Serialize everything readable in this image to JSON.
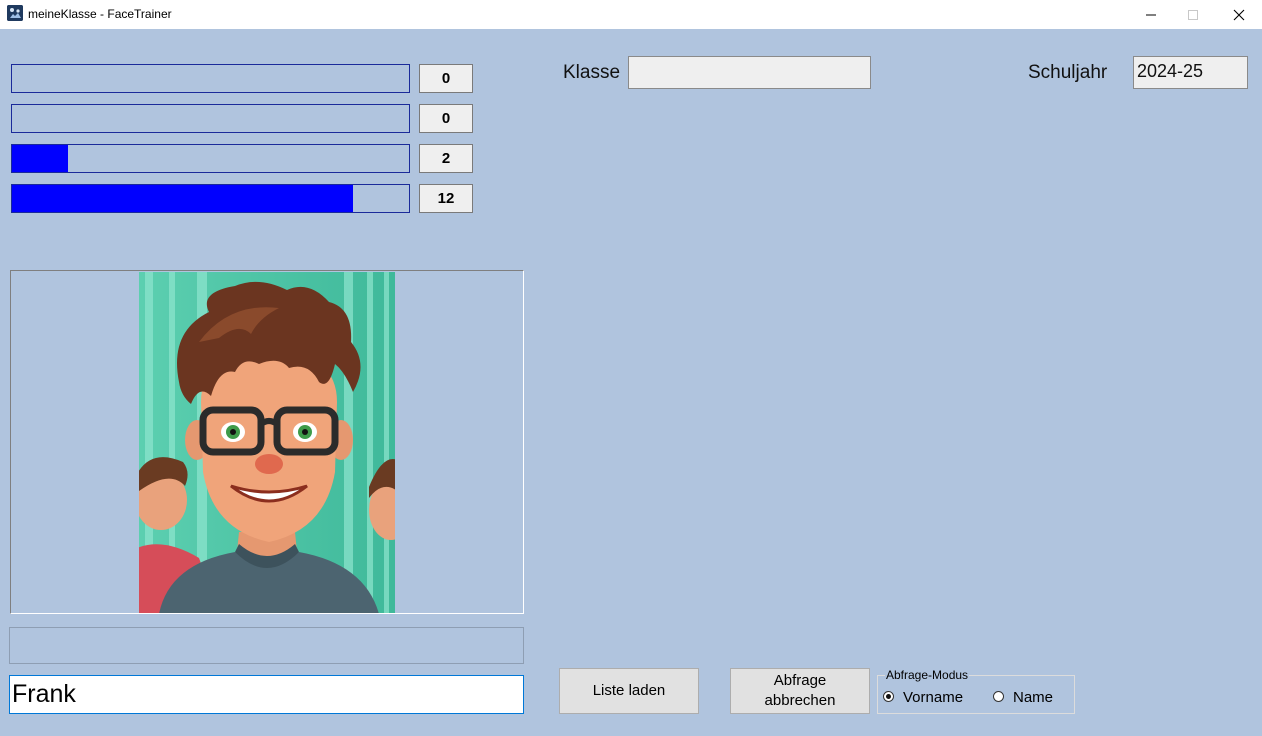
{
  "window": {
    "title": "meineKlasse - FaceTrainer",
    "controls": {
      "minimize": "minimize-icon",
      "maximize": "maximize-icon",
      "close": "close-icon"
    }
  },
  "progress": [
    {
      "fraction": 0.0,
      "count": "0"
    },
    {
      "fraction": 0.0,
      "count": "0"
    },
    {
      "fraction": 0.14,
      "count": "2"
    },
    {
      "fraction": 0.86,
      "count": "12"
    }
  ],
  "colors": {
    "background": "#b0c4de",
    "bar_fill": "#0000ff",
    "bar_border": "#1a2a9a"
  },
  "header": {
    "klasse_label": "Klasse",
    "klasse_value": "",
    "schuljahr_label": "Schuljahr",
    "schuljahr_value": "2024-25"
  },
  "status_text": "",
  "answer": {
    "value": "Frank"
  },
  "buttons": {
    "load_list": "Liste laden",
    "cancel_quiz_line1": "Abfrage",
    "cancel_quiz_line2": "abbrechen"
  },
  "mode": {
    "legend": "Abfrage-Modus",
    "options": [
      {
        "label": "Vorname",
        "checked": true
      },
      {
        "label": "Name",
        "checked": false
      }
    ]
  }
}
